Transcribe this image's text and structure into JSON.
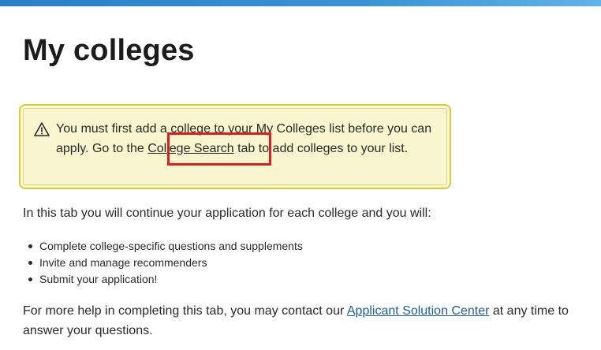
{
  "page": {
    "title": "My colleges"
  },
  "alert": {
    "icon": "warning-triangle-icon",
    "text_before": "You must first add a college to your My Colleges list before you can apply. Go to the ",
    "link_label": "College Search",
    "text_after": " tab to add colleges to your list."
  },
  "content": {
    "intro": "In this tab you will continue your application for each college and you will:",
    "bullets": [
      "Complete college-specific questions and supplements",
      "Invite and manage recommenders",
      "Submit your application!"
    ],
    "help_before": "For more help in completing this tab, you may contact our ",
    "help_link": "Applicant Solution Center",
    "help_after": " at any time to answer your questions."
  },
  "colors": {
    "alert_background": "#f8f5cf",
    "alert_border": "#d8c93f",
    "link": "#1a5fa6",
    "highlight": "#e01d1d",
    "top_bar": "#2a7fc4"
  }
}
